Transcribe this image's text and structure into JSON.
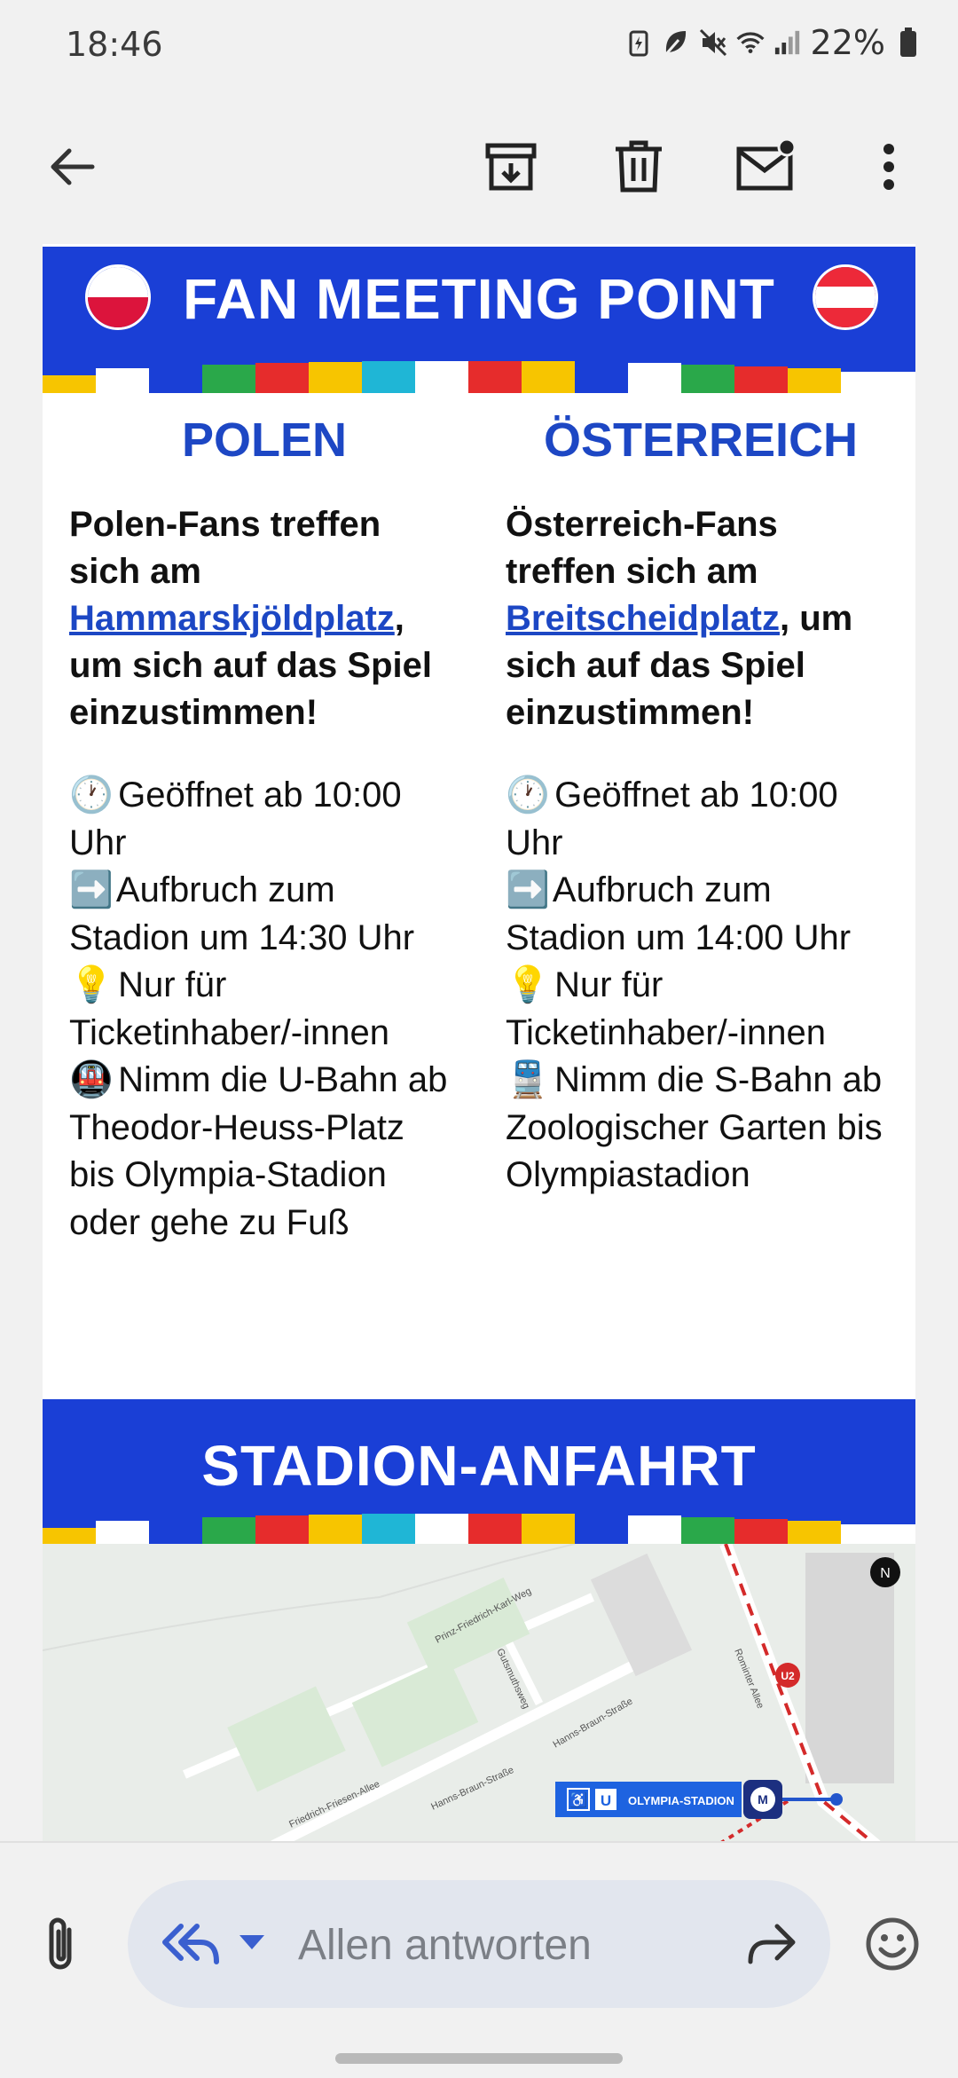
{
  "status_bar": {
    "time": "18:46",
    "battery": "22%",
    "icons": [
      "battery-saver-icon",
      "leaf-icon",
      "mute-icon",
      "wifi-icon",
      "signal-icon",
      "battery-icon"
    ]
  },
  "toolbar": {
    "icons": [
      "back-arrow-icon",
      "archive-icon",
      "delete-icon",
      "mark-unread-icon",
      "more-vert-icon"
    ]
  },
  "email": {
    "banner1": {
      "title": "FAN MEETING POINT"
    },
    "poland": {
      "title": "POLEN",
      "intro_before": "Polen-Fans treffen sich am ",
      "place": "Hammarskjöldplatz",
      "intro_after": ", um sich auf das Spiel einzustimmen!",
      "line1": "Geöffnet ab 10:00 Uhr",
      "line2": "Aufbruch zum Stadion um 14:30 Uhr",
      "line3": "Nur für Ticketinhaber/-innen",
      "line4": "Nimm die U-Bahn ab Theodor-Heuss-Platz bis Olympia-Stadion oder gehe zu Fuß"
    },
    "austria": {
      "title": "ÖSTERREICH",
      "intro_before": "Österreich-Fans treffen sich am ",
      "place": "Breitscheidplatz",
      "intro_after": ", um sich auf das Spiel einzustimmen!",
      "line1": "Geöffnet ab 10:00 Uhr",
      "line2": "Aufbruch zum Stadion um 14:00 Uhr",
      "line3": "Nur für Ticketinhaber/-innen",
      "line4": "Nimm die S-Bahn ab Zoologischer Garten bis Olympiastadion"
    },
    "banner2": {
      "title": "STADION-ANFAHRT"
    },
    "map": {
      "streets": [
        "Prinz-Friedrich-Karl-Weg",
        "Gutsmuthsweg",
        "Hanns-Braun-Straße",
        "Hanns-Braun-Straße",
        "Friedrich-Friesen-Allee",
        "Rominter Allee"
      ],
      "line_badge": "U2",
      "station_label": "OLYMPIA-STADION",
      "station_sign": "U",
      "compass": "N"
    }
  },
  "reply_bar": {
    "placeholder": "Allen antworten"
  },
  "colors": {
    "banner_blue": "#1a3fd6",
    "heading_blue": "#1d47c4",
    "link_blue": "#1c47c4"
  }
}
